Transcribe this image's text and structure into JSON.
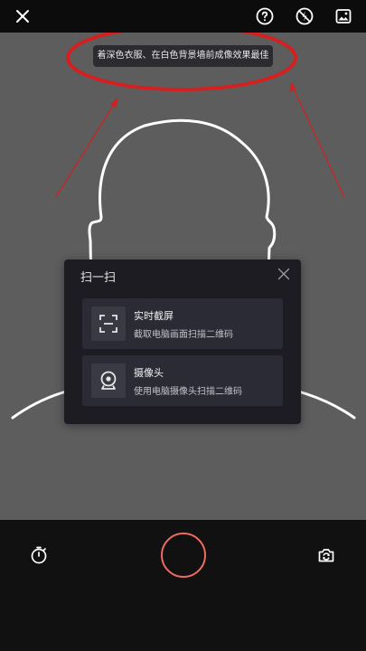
{
  "top_bar": {
    "icons": [
      "close-icon",
      "help-icon",
      "flash-off-icon",
      "gallery-icon"
    ]
  },
  "tip": {
    "text": "着深色衣服、在白色背景墙前成像效果最佳"
  },
  "scan_dialog": {
    "title": "扫一扫",
    "options": [
      {
        "icon": "screenshot-icon",
        "title": "实时截屏",
        "subtitle": "截取电脑画面扫描二维码"
      },
      {
        "icon": "webcam-icon",
        "title": "摄像头",
        "subtitle": "使用电脑摄像头扫描二维码"
      }
    ]
  },
  "bottom_bar": {
    "icons": [
      "timer-icon",
      "shutter-button",
      "flip-camera-icon"
    ]
  },
  "colors": {
    "annotation_red": "#d42020",
    "shutter_ring": "#ee6a62",
    "camera_bg": "#5d5d5d",
    "dialog_bg": "#1c1c22"
  }
}
